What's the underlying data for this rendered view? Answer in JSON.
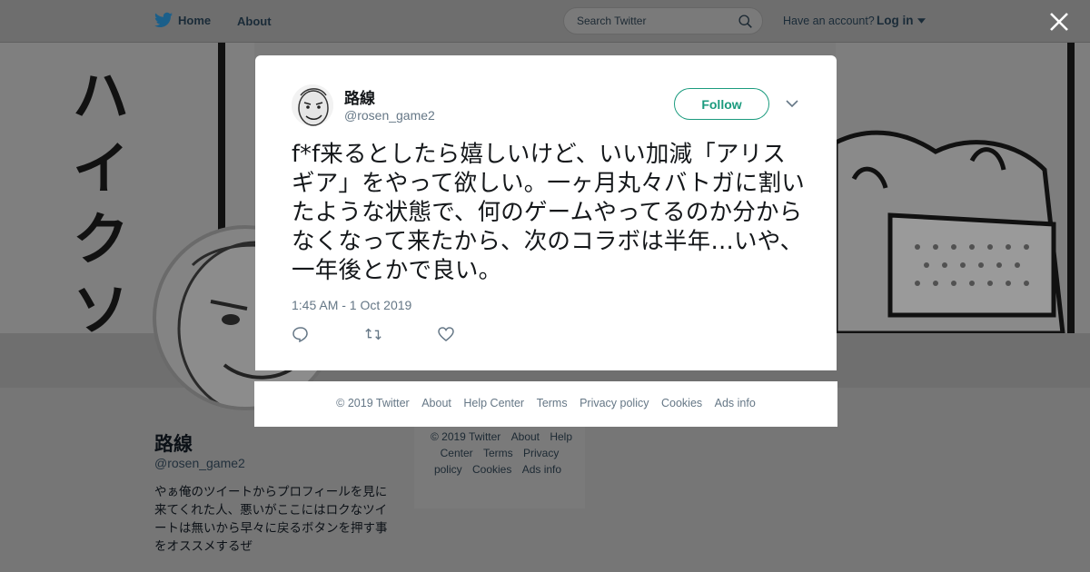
{
  "nav": {
    "home_label": "Home",
    "about_label": "About",
    "search_placeholder": "Search Twitter",
    "account_prompt": "Have an account?",
    "login_label": "Log in"
  },
  "banner": {
    "chars": [
      "ハ",
      "イ",
      "ク",
      "ソ"
    ]
  },
  "profile": {
    "name": "路線",
    "handle": "@rosen_game2",
    "bio": "やぁ俺のツイートからプロフィールを見に来てくれた人、悪いがここにはロクなツイートは無いから早々に戻るボタンを押す事をオススメするぜ"
  },
  "side_footer": {
    "links": [
      "© 2019 Twitter",
      "About",
      "Help Center",
      "Terms",
      "Privacy policy",
      "Cookies",
      "Ads info"
    ]
  },
  "tweet": {
    "name": "路線",
    "handle": "@rosen_game2",
    "follow_label": "Follow",
    "text": "f*f来るとしたら嬉しいけど、いい加減「アリスギア」をやって欲しい。一ヶ月丸々バトガに割いたような状態で、何のゲームやってるのか分からなくなって来たから、次のコラボは半年…いや、一年後とかで良い。",
    "timestamp": "1:45 AM - 1 Oct 2019"
  },
  "modal_footer": {
    "links": [
      "© 2019 Twitter",
      "About",
      "Help Center",
      "Terms",
      "Privacy policy",
      "Cookies",
      "Ads info"
    ]
  },
  "colors": {
    "accent": "#1b9b7e",
    "twitter_blue": "#1da1f2",
    "secondary_text": "#657786"
  }
}
